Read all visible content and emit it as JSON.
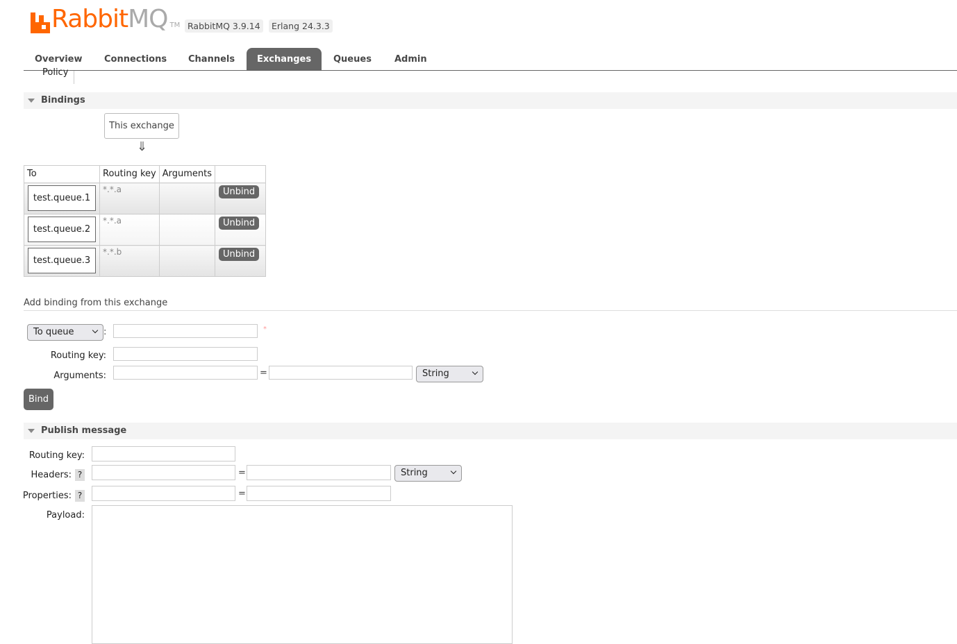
{
  "header": {
    "logo_rabbit": "Rabbit",
    "logo_mq": "MQ",
    "logo_tm": "TM",
    "version": "RabbitMQ 3.9.14",
    "erlang": "Erlang 24.3.3"
  },
  "colors": {
    "brand": "#ff6600",
    "tab_active": "#666666"
  },
  "tabs": [
    {
      "label": "Overview"
    },
    {
      "label": "Connections"
    },
    {
      "label": "Channels"
    },
    {
      "label": "Exchanges",
      "active": true
    },
    {
      "label": "Queues"
    },
    {
      "label": "Admin"
    }
  ],
  "submenu": {
    "policy": "Policy"
  },
  "bindings": {
    "title": "Bindings",
    "source": "This exchange",
    "arrow": "⇓",
    "columns": [
      "To",
      "Routing key",
      "Arguments",
      ""
    ],
    "rows": [
      {
        "to": "test.queue.1",
        "routing_key": "*.*.a",
        "arguments": "",
        "action": "Unbind"
      },
      {
        "to": "test.queue.2",
        "routing_key": "*.*.a",
        "arguments": "",
        "action": "Unbind"
      },
      {
        "to": "test.queue.3",
        "routing_key": "*.*.b",
        "arguments": "",
        "action": "Unbind"
      }
    ]
  },
  "add_binding": {
    "title": "Add binding from this exchange",
    "destination_type": "To queue",
    "colon": ":",
    "required": "*",
    "routing_key_label": "Routing key:",
    "arguments_label": "Arguments:",
    "eq": "=",
    "arg_type": "String",
    "bind_label": "Bind"
  },
  "publish": {
    "title": "Publish message",
    "routing_key_label": "Routing key:",
    "headers_label": "Headers:",
    "properties_label": "Properties:",
    "payload_label": "Payload:",
    "help": "?",
    "eq": "=",
    "header_type": "String"
  }
}
